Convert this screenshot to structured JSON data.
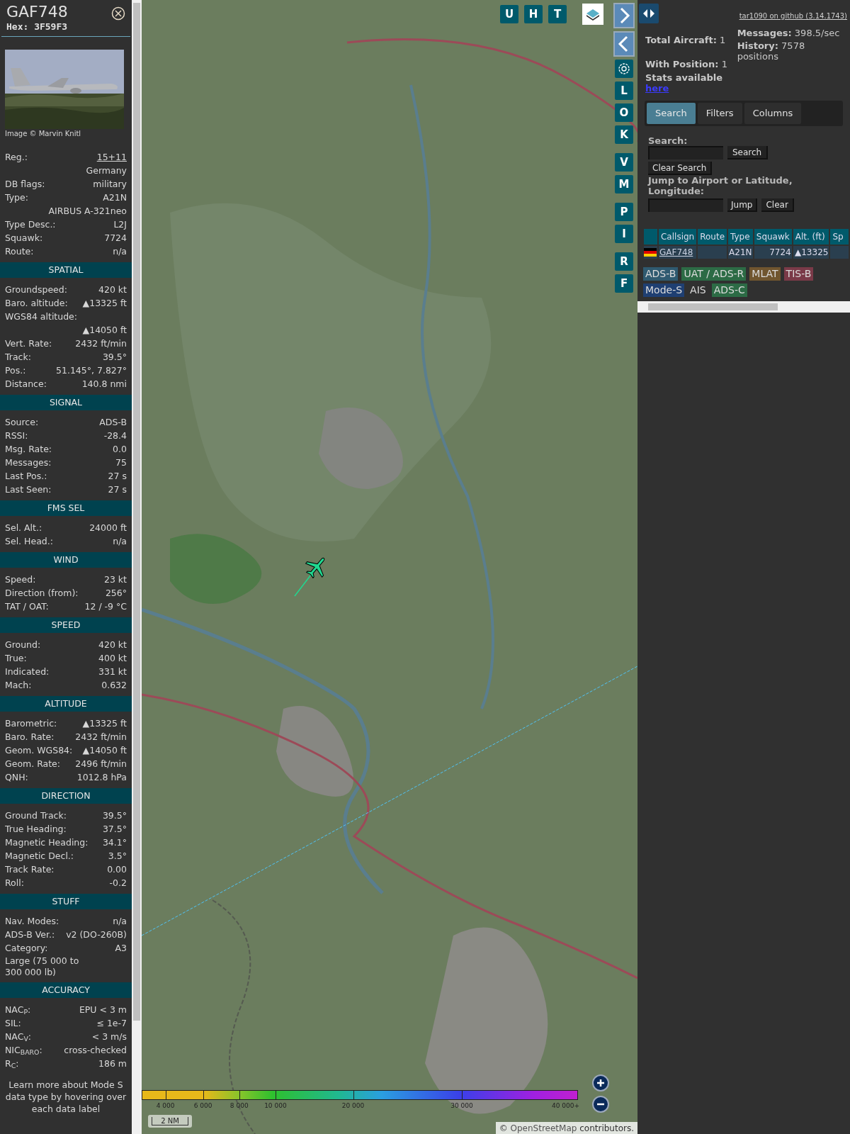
{
  "info_panel": {
    "callsign": "GAF748",
    "hex": "Hex: 3F59F3",
    "photo_credit": "Image © Marvin Knitl",
    "rows": [
      {
        "kind": "link",
        "label": "Reg.:",
        "value": "15+11"
      },
      {
        "kind": "value",
        "value": "Germany"
      },
      {
        "kind": "pair",
        "label": "DB flags:",
        "value": "military"
      },
      {
        "kind": "pair",
        "label": "Type:",
        "value": "A21N"
      },
      {
        "kind": "value",
        "value": "AIRBUS A-321neo"
      },
      {
        "kind": "pair",
        "label": "Type Desc.:",
        "value": "L2J"
      },
      {
        "kind": "pair",
        "label": "Squawk:",
        "value": "7724"
      },
      {
        "kind": "pair",
        "label": "Route:",
        "value": "n/a"
      }
    ],
    "sections": [
      {
        "title": "SPATIAL",
        "rows": [
          {
            "kind": "pair",
            "label": "Groundspeed:",
            "value": "420 kt"
          },
          {
            "kind": "pair",
            "label": "Baro. altitude:",
            "value": "▲13325 ft"
          },
          {
            "kind": "label",
            "label": "WGS84 altitude:"
          },
          {
            "kind": "value",
            "value": "▲14050 ft"
          },
          {
            "kind": "pair",
            "label": "Vert. Rate:",
            "value": "2432 ft/min"
          },
          {
            "kind": "pair",
            "label": "Track:",
            "value": "39.5°"
          },
          {
            "kind": "pair",
            "label": "Pos.:",
            "value": "51.145°, 7.827°"
          },
          {
            "kind": "pair",
            "label": "Distance:",
            "value": "140.8 nmi"
          }
        ]
      },
      {
        "title": "SIGNAL",
        "rows": [
          {
            "kind": "pair",
            "label": "Source:",
            "value": "ADS-B"
          },
          {
            "kind": "pair",
            "label": "RSSI:",
            "value": "-28.4"
          },
          {
            "kind": "pair",
            "label": "Msg. Rate:",
            "value": "0.0"
          },
          {
            "kind": "pair",
            "label": "Messages:",
            "value": "75"
          },
          {
            "kind": "pair",
            "label": "Last Pos.:",
            "value": "27 s"
          },
          {
            "kind": "pair",
            "label": "Last Seen:",
            "value": "27 s"
          }
        ]
      },
      {
        "title": "FMS SEL",
        "rows": [
          {
            "kind": "pair",
            "label": "Sel. Alt.:",
            "value": "24000 ft"
          },
          {
            "kind": "pair",
            "label": "Sel. Head.:",
            "value": "n/a"
          }
        ]
      },
      {
        "title": "WIND",
        "rows": [
          {
            "kind": "pair",
            "label": "Speed:",
            "value": "23 kt"
          },
          {
            "kind": "pair",
            "label": "Direction (from):",
            "value": "256°"
          },
          {
            "kind": "pair",
            "label": "TAT / OAT:",
            "value": "12 / -9 °C"
          }
        ]
      },
      {
        "title": "SPEED",
        "rows": [
          {
            "kind": "pair",
            "label": "Ground:",
            "value": "420 kt"
          },
          {
            "kind": "pair",
            "label": "True:",
            "value": "400 kt"
          },
          {
            "kind": "pair",
            "label": "Indicated:",
            "value": "331 kt"
          },
          {
            "kind": "pair",
            "label": "Mach:",
            "value": "0.632"
          }
        ]
      },
      {
        "title": "ALTITUDE",
        "rows": [
          {
            "kind": "pair",
            "label": "Barometric:",
            "value": "▲13325 ft"
          },
          {
            "kind": "pair",
            "label": "Baro. Rate:",
            "value": "2432 ft/min"
          },
          {
            "kind": "pair",
            "label": "Geom. WGS84:",
            "value": "▲14050 ft"
          },
          {
            "kind": "pair",
            "label": "Geom. Rate:",
            "value": "2496 ft/min"
          },
          {
            "kind": "pair",
            "label": "QNH:",
            "value": "1012.8 hPa"
          }
        ]
      },
      {
        "title": "DIRECTION",
        "rows": [
          {
            "kind": "pair",
            "label": "Ground Track:",
            "value": "39.5°"
          },
          {
            "kind": "pair",
            "label": "True Heading:",
            "value": "37.5°"
          },
          {
            "kind": "pair",
            "label": "Magnetic Heading:",
            "value": "34.1°"
          },
          {
            "kind": "pair",
            "label": "Magnetic Decl.:",
            "value": "3.5°"
          },
          {
            "kind": "pair",
            "label": "Track Rate:",
            "value": "0.00"
          },
          {
            "kind": "pair",
            "label": "Roll:",
            "value": "-0.2"
          }
        ]
      },
      {
        "title": "STUFF",
        "rows": [
          {
            "kind": "pair",
            "label": "Nav. Modes:",
            "value": "n/a"
          },
          {
            "kind": "pair",
            "label": "ADS-B Ver.:",
            "value": "v2 (DO-260B)"
          },
          {
            "kind": "pair",
            "label": "Category:",
            "value": "A3"
          },
          {
            "kind": "wide",
            "label": "Large (75 000 to 300 000 lb)"
          }
        ]
      },
      {
        "title": "ACCURACY",
        "rows": [
          {
            "kind": "pair",
            "label": "NAC$_{P}$:",
            "value": "EPU < 3 m"
          },
          {
            "kind": "pair",
            "label": "SIL:",
            "value": "≤ 1e-7"
          },
          {
            "kind": "pair",
            "label": "NAC$_{V}$:",
            "value": "< 3 m/s"
          },
          {
            "kind": "pair",
            "label": "NIC$_{BARO}$:",
            "value": "cross-checked"
          },
          {
            "kind": "pair",
            "label": "R$_{C}$:",
            "value": "186 m"
          }
        ]
      }
    ],
    "footer": "Learn more about Mode S data type by hovering over each data label"
  },
  "map": {
    "top_buttons": [
      "U",
      "H",
      "T"
    ],
    "side_buttons": [
      "L",
      "O",
      "K",
      "V",
      "M",
      "P",
      "I",
      "R",
      "F"
    ],
    "legend_ticks": [
      "4 000",
      "6 000",
      "8 000",
      "10 000",
      "20 000",
      "30 000",
      "40 000+"
    ],
    "scale": "2 NM",
    "attribution_prefix": "© ",
    "attribution_link": "OpenStreetMap",
    "attribution_suffix": " contributors."
  },
  "right_panel": {
    "github_link": "tar1090 on github (3.14.1743)",
    "stats": [
      {
        "label": "Total Aircraft:",
        "value": "1"
      },
      {
        "label": "With Position:",
        "value": "1"
      },
      {
        "label": "Messages:",
        "value": "398.5/sec"
      },
      {
        "label": "History:",
        "value": "7578 positions"
      }
    ],
    "stats_note": "Stats available",
    "stats_link": "here",
    "tabs": [
      {
        "label": "Search",
        "selected": true
      },
      {
        "label": "Filters",
        "selected": false
      },
      {
        "label": "Columns",
        "selected": false
      }
    ],
    "search_label": "Search:",
    "search_button": "Search",
    "clear_search_button": "Clear Search",
    "jump_label": "Jump to Airport or Latitude, Longitude:",
    "jump_button": "Jump",
    "clear_button": "Clear",
    "table": {
      "columns": [
        "Callsign",
        "Route",
        "Type",
        "Squawk",
        "Alt. (ft)",
        "Sp"
      ],
      "rows": [
        {
          "callsign": "GAF748",
          "type": "A21N",
          "squawk": "7724",
          "altitude": "▲13325"
        }
      ]
    },
    "sources": [
      {
        "label": "ADS-B",
        "color": "#2f5a70"
      },
      {
        "label": "UAT / ADS-R",
        "color": "#2c6b45"
      },
      {
        "label": "MLAT",
        "color": "#70552f"
      },
      {
        "label": "TIS-B",
        "color": "#7a3a48"
      },
      {
        "label": "Mode-S",
        "color": "#1f3f72"
      },
      {
        "label": "AIS"
      },
      {
        "label": "ADS-C",
        "color": "#2c6b45"
      }
    ]
  }
}
